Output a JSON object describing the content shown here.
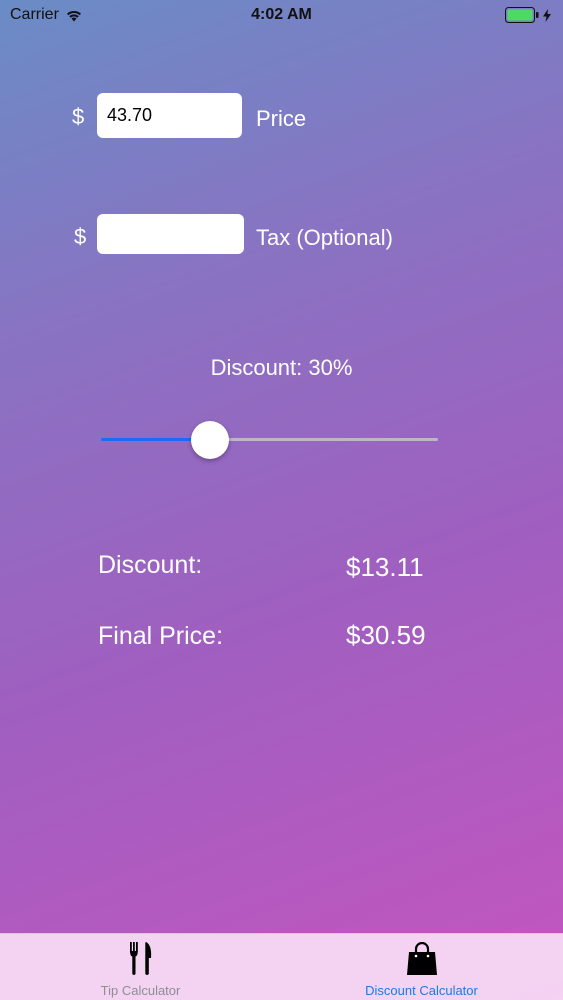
{
  "status_bar": {
    "carrier": "Carrier",
    "time": "4:02 AM",
    "battery_color": "#4cd964"
  },
  "price": {
    "currency": "$",
    "value": "43.70",
    "label": "Price"
  },
  "tax": {
    "currency": "$",
    "value": "",
    "label": "Tax (Optional)"
  },
  "discount_slider": {
    "label": "Discount:  30%",
    "percent": 30,
    "min_track_color": "#1a6cf5"
  },
  "results": {
    "discount_label": "Discount:",
    "discount_value": "$13.11",
    "final_label": "Final Price:",
    "final_value": "$30.59"
  },
  "tab_bar": {
    "tabs": [
      {
        "label": "Tip Calculator",
        "icon": "fork-knife-icon",
        "selected": false
      },
      {
        "label": "Discount Calculator",
        "icon": "shopping-bag-icon",
        "selected": true
      }
    ],
    "selected_color": "#1f7ae0",
    "unselected_color": "#8e8e93"
  }
}
